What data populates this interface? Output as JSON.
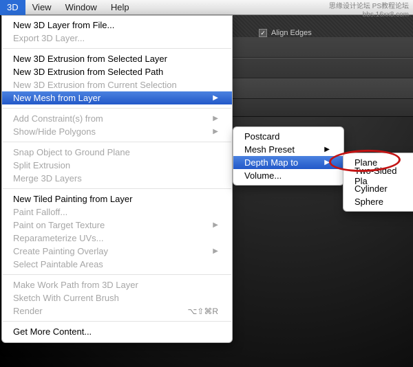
{
  "menubar": {
    "items": [
      "3D",
      "View",
      "Window",
      "Help"
    ]
  },
  "watermark": {
    "line1": "思缘设计论坛 PS教程论坛",
    "line2": "bbs.16xx8.com"
  },
  "align_edges": {
    "label": "Align Edges",
    "checked": true
  },
  "menu1": {
    "new_3d_layer": "New 3D Layer from File...",
    "export_3d_layer": "Export 3D Layer...",
    "new_extrusion_layer": "New 3D Extrusion from Selected Layer",
    "new_extrusion_path": "New 3D Extrusion from Selected Path",
    "new_extrusion_selection": "New 3D Extrusion from Current Selection",
    "new_mesh": "New Mesh from Layer",
    "add_constraints": "Add Constraint(s) from",
    "show_hide_polygons": "Show/Hide Polygons",
    "snap_ground": "Snap Object to Ground Plane",
    "split_extrusion": "Split Extrusion",
    "merge_3d": "Merge 3D Layers",
    "new_tiled": "New Tiled Painting from Layer",
    "paint_falloff": "Paint Falloff...",
    "paint_target": "Paint on Target Texture",
    "reparam_uvs": "Reparameterize UVs...",
    "create_overlay": "Create Painting Overlay",
    "select_paintable": "Select Paintable Areas",
    "make_work_path": "Make Work Path from 3D Layer",
    "sketch_brush": "Sketch With Current Brush",
    "render": "Render",
    "render_shortcut": "⌥⇧⌘R",
    "get_more": "Get More Content..."
  },
  "menu2": {
    "postcard": "Postcard",
    "mesh_preset": "Mesh Preset",
    "depth_map": "Depth Map to",
    "volume": "Volume..."
  },
  "menu3": {
    "plane": "Plane",
    "two_sided": "Two-Sided Pla",
    "cylinder": "Cylinder",
    "sphere": "Sphere"
  }
}
